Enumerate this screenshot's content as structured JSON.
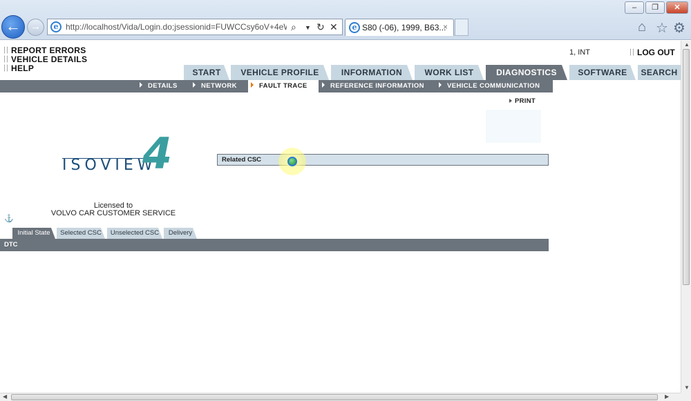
{
  "browser": {
    "address_url": "http://localhost/Vida/Login.do;jsessionid=FUWCCsy6oV+4eW",
    "tab_title": "S80 (-06), 1999, B63...",
    "tab_close": "×",
    "back_glyph": "←",
    "forward_glyph": "→",
    "window_buttons": {
      "minimize": "–",
      "maximize": "❐",
      "close": "✕"
    },
    "icons": [
      "ie-logo-icon",
      "search-icon",
      "dropdown-icon",
      "refresh-icon",
      "stop-icon",
      "home-icon",
      "favorites-star-icon",
      "gear-icon"
    ]
  },
  "header": {
    "links": [
      "REPORT ERRORS",
      "VEHICLE DETAILS",
      "HELP"
    ],
    "user": "1, INT",
    "logout": "LOG OUT"
  },
  "main_tabs": [
    {
      "label": "START",
      "active": false
    },
    {
      "label": "VEHICLE PROFILE",
      "active": false
    },
    {
      "label": "INFORMATION",
      "active": false
    },
    {
      "label": "WORK LIST",
      "active": false
    },
    {
      "label": "DIAGNOSTICS",
      "active": true
    },
    {
      "label": "SOFTWARE",
      "active": false
    },
    {
      "label": "SEARCH",
      "active": false
    }
  ],
  "sub_nav": [
    {
      "label": "DETAILS",
      "active": false
    },
    {
      "label": "NETWORK",
      "active": false
    },
    {
      "label": "FAULT TRACE",
      "active": true
    },
    {
      "label": "REFERENCE INFORMATION",
      "active": false
    },
    {
      "label": "VEHICLE COMMUNICATION",
      "active": false
    }
  ],
  "print_label": "PRINT",
  "logo": {
    "text": "ISOVIEW",
    "digit": "4",
    "accent_color": "#3a9ea0",
    "text_color": "#1d4f7a"
  },
  "related_csc": {
    "label": "Related CSC"
  },
  "license": {
    "line1": "Licensed to",
    "line2": "VOLVO CAR CUSTOMER SERVICE"
  },
  "content_tabs": [
    {
      "label": "Initial State",
      "active": true
    },
    {
      "label": "Selected CSC",
      "active": false
    },
    {
      "label": "Unselected CSC",
      "active": false
    },
    {
      "label": "Delivery",
      "active": false
    }
  ],
  "dtc_header": "DTC",
  "colors": {
    "nav_dark": "#6b737c",
    "tab_light": "#c7d7e1",
    "active_marker": "#e07a10"
  }
}
